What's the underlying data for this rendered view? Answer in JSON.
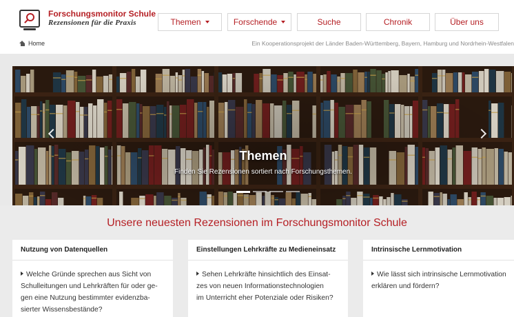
{
  "brand": {
    "title": "Forschungsmonitor Schule",
    "subtitle": "Rezensionen für die Praxis"
  },
  "nav": {
    "items": [
      {
        "label": "Themen",
        "dropdown": true
      },
      {
        "label": "Forschende",
        "dropdown": true
      },
      {
        "label": "Suche",
        "dropdown": false
      },
      {
        "label": "Chronik",
        "dropdown": false
      },
      {
        "label": "Über uns",
        "dropdown": false
      }
    ]
  },
  "breadcrumb": {
    "home": "Home"
  },
  "tagline": "Ein Kooperationsprojekt der Länder Baden-Württemberg, Bayern, Hamburg und Nordrhein-Westfalen",
  "carousel": {
    "title": "Themen",
    "caption": "Finden Sie Rezensionen sortiert nach Forschungsthemen.",
    "slide_count": 4,
    "active_index": 0
  },
  "latest": {
    "heading": "Unsere neuesten Rezensionen im Forschungsmonitor Schule",
    "cards": [
      {
        "title": "Nutzung von Datenquellen",
        "lines": [
          "Welche Gründe sprechen aus Sicht von",
          "Schulleitungen und Lehrkräften für oder ge-",
          "gen eine Nutzung bestimmter evidenzba-",
          "sierter Wissensbestände?"
        ]
      },
      {
        "title": "Einstellungen Lehrkräfte zu Medieneinsatz",
        "lines": [
          "Sehen Lehrkräfte hinsichtlich des Einsat-",
          "zes von neuen Informationstechnologien",
          "im Unterricht eher Potenziale oder Risiken?"
        ]
      },
      {
        "title": "Intrinsische Lernmotivation",
        "lines": [
          "Wie lässt sich intrinsische Lernmotivation",
          "erklären und fördern?"
        ]
      }
    ]
  },
  "colors": {
    "brand_red": "#b51f24",
    "section_bg": "#ebebeb"
  }
}
